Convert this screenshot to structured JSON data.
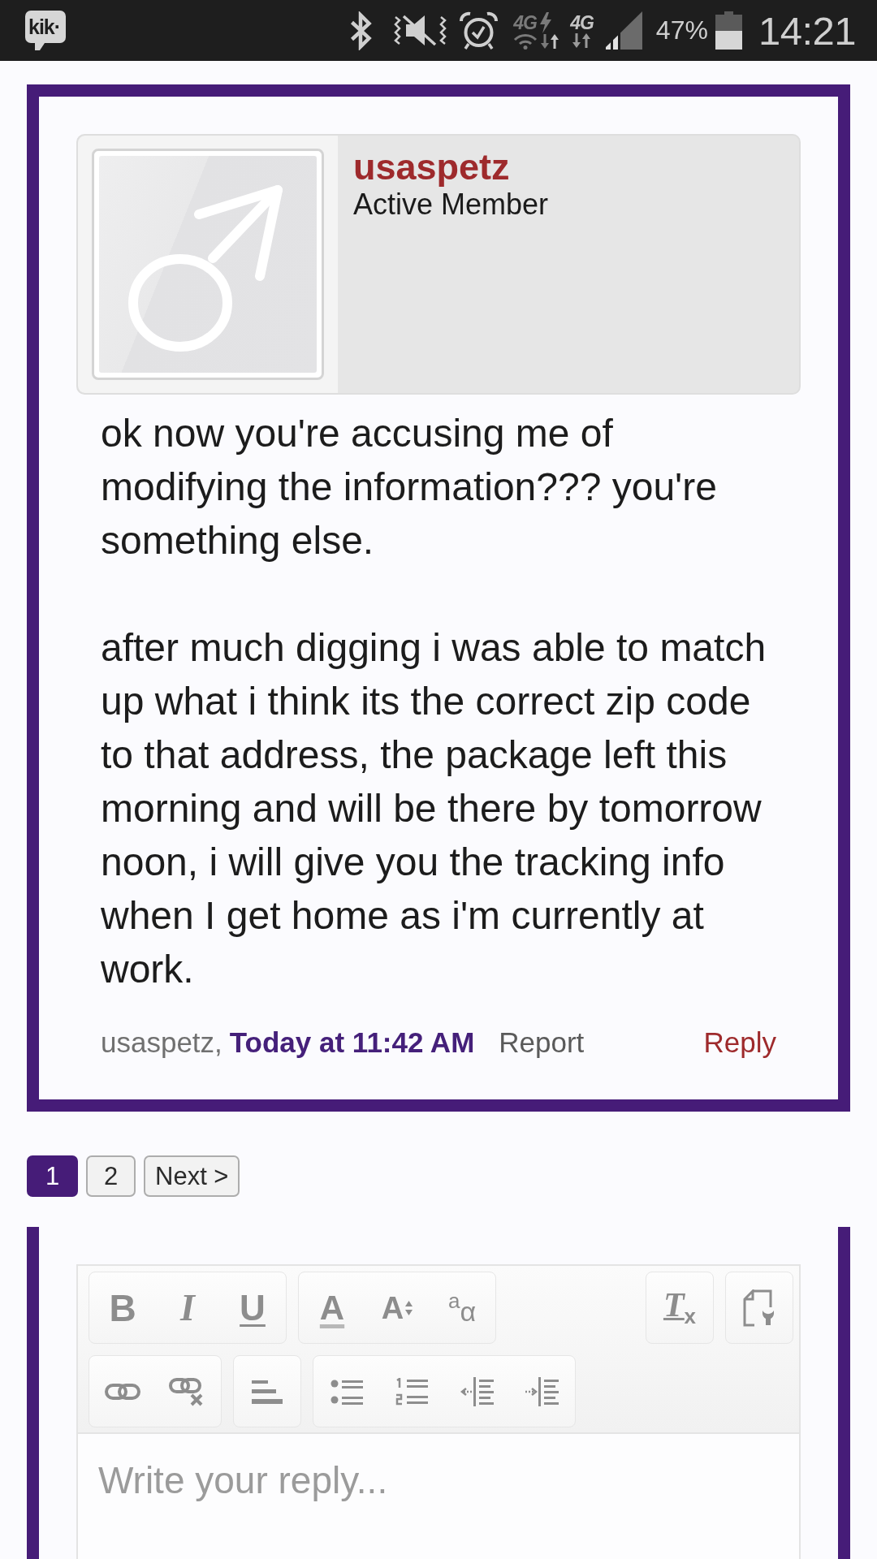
{
  "status_bar": {
    "app_logo": "kik·",
    "indicators": [
      {
        "kind": "wifi-4g",
        "label": "4G"
      },
      {
        "kind": "mobile-4g",
        "label": "4G"
      }
    ],
    "battery_percent": "47%",
    "time": "14:21"
  },
  "post": {
    "author": {
      "name": "usaspetz",
      "title": "Active Member"
    },
    "paragraphs": [
      "ok now you're accusing me of modifying the information??? you're something else.",
      "after much digging i was able to match up what i think its the correct zip code to that address, the package left this morning and will be there by tomorrow noon, i will give you the tracking info when I get home as i'm currently at work."
    ],
    "footer": {
      "author": "usaspetz,",
      "date": "Today at 11:42 AM",
      "actions": [
        {
          "kind": "report",
          "label": "Report"
        },
        {
          "kind": "reply",
          "label": "Reply"
        }
      ]
    }
  },
  "pagination": {
    "pages": [
      {
        "label": "1",
        "selected": true
      },
      {
        "label": "2",
        "selected": false
      }
    ],
    "next": "Next >"
  },
  "editor": {
    "toolbar": [
      {
        "left": [
          {
            "buttons": [
              {
                "kind": "bold",
                "glyph": "B"
              },
              {
                "kind": "italic",
                "glyph": "I"
              },
              {
                "kind": "underline",
                "glyph": "U"
              }
            ]
          },
          {
            "buttons": [
              {
                "kind": "text-color",
                "glyph": "A"
              },
              {
                "kind": "font-size",
                "glyph": "A"
              },
              {
                "kind": "case-transform",
                "glyph": "$^{a}$α"
              }
            ]
          }
        ],
        "right": [
          {
            "buttons": [
              {
                "kind": "remove-format",
                "glyph": "T$_{x}$"
              }
            ]
          },
          {
            "buttons": [
              {
                "kind": "source"
              }
            ]
          }
        ]
      },
      {
        "left": [
          {
            "buttons": [
              {
                "kind": "link"
              },
              {
                "kind": "unlink"
              }
            ]
          },
          {
            "buttons": [
              {
                "kind": "align-left"
              }
            ]
          },
          {
            "buttons": [
              {
                "kind": "bullet-list"
              },
              {
                "kind": "numbered-list"
              },
              {
                "kind": "outdent"
              },
              {
                "kind": "indent"
              }
            ]
          }
        ]
      }
    ],
    "placeholder": "Write your reply..."
  }
}
